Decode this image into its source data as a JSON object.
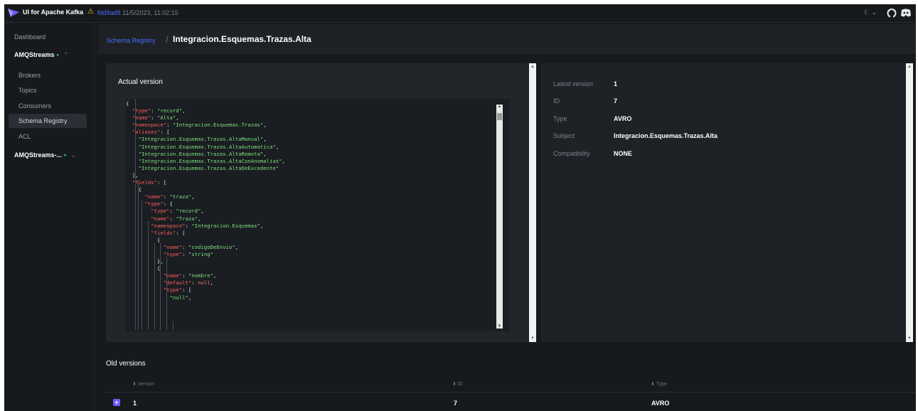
{
  "app": {
    "title": "UI for Apache Kafka",
    "commit_hash": "fdd9ad9",
    "commit_date": "11/5/2023, 11:02:15",
    "theme_toggle": "☾ ⌄"
  },
  "sidebar": {
    "dashboard": "Dashboard",
    "cluster1": "AMQStreams",
    "items": [
      "Brokers",
      "Topics",
      "Consumers",
      "Schema Registry",
      "ACL"
    ],
    "cluster2": "AMQStreams-..."
  },
  "breadcrumb": {
    "link": "Schema Registry",
    "separator": "/",
    "title": "Integracion.Esquemas.Trazas.Alta"
  },
  "schema": {
    "actual_label": "Actual version",
    "lines": [
      [
        [
          "{",
          "p"
        ]
      ],
      [
        [
          "  ",
          "p"
        ],
        [
          "\"type\"",
          "k"
        ],
        [
          ": ",
          "p"
        ],
        [
          "\"record\"",
          "s"
        ],
        [
          ",",
          "p"
        ]
      ],
      [
        [
          "  ",
          "p"
        ],
        [
          "\"name\"",
          "k"
        ],
        [
          ": ",
          "p"
        ],
        [
          "\"Alta\"",
          "s"
        ],
        [
          ",",
          "p"
        ]
      ],
      [
        [
          "  ",
          "p"
        ],
        [
          "\"namespace\"",
          "k"
        ],
        [
          ": ",
          "p"
        ],
        [
          "\"Integracion.Esquemas.Trazas\"",
          "s"
        ],
        [
          ",",
          "p"
        ]
      ],
      [
        [
          "  ",
          "p"
        ],
        [
          "\"aliases\"",
          "k"
        ],
        [
          ": [",
          "p"
        ]
      ],
      [
        [
          "    ",
          "p"
        ],
        [
          "\"Integracion.Esquemas.Trazas.AltaManual\"",
          "s"
        ],
        [
          ",",
          "p"
        ]
      ],
      [
        [
          "    ",
          "p"
        ],
        [
          "\"Integracion.Esquemas.Trazas.AltaAutomatica\"",
          "s"
        ],
        [
          ",",
          "p"
        ]
      ],
      [
        [
          "    ",
          "p"
        ],
        [
          "\"Integracion.Esquemas.Trazas.AltaRemota\"",
          "s"
        ],
        [
          ",",
          "p"
        ]
      ],
      [
        [
          "    ",
          "p"
        ],
        [
          "\"Integracion.Esquemas.Trazas.AltaConAnomalias\"",
          "s"
        ],
        [
          ",",
          "p"
        ]
      ],
      [
        [
          "    ",
          "p"
        ],
        [
          "\"Integracion.Esquemas.Trazas.AltaDeExcedente\"",
          "s"
        ]
      ],
      [
        [
          "  ],",
          "p"
        ]
      ],
      [
        [
          "  ",
          "p"
        ],
        [
          "\"fields\"",
          "k"
        ],
        [
          ": [",
          "p"
        ]
      ],
      [
        [
          "    {",
          "p"
        ]
      ],
      [
        [
          "      ",
          "p"
        ],
        [
          "\"name\"",
          "k"
        ],
        [
          ": ",
          "p"
        ],
        [
          "\"traza\"",
          "s"
        ],
        [
          ",",
          "p"
        ]
      ],
      [
        [
          "      ",
          "p"
        ],
        [
          "\"type\"",
          "k"
        ],
        [
          ": {",
          "p"
        ]
      ],
      [
        [
          "        ",
          "p"
        ],
        [
          "\"type\"",
          "k"
        ],
        [
          ": ",
          "p"
        ],
        [
          "\"record\"",
          "s"
        ],
        [
          ",",
          "p"
        ]
      ],
      [
        [
          "        ",
          "p"
        ],
        [
          "\"name\"",
          "k"
        ],
        [
          ": ",
          "p"
        ],
        [
          "\"Traza\"",
          "s"
        ],
        [
          ",",
          "p"
        ]
      ],
      [
        [
          "        ",
          "p"
        ],
        [
          "\"namespace\"",
          "k"
        ],
        [
          ": ",
          "p"
        ],
        [
          "\"Integracion.Esquemas\"",
          "s"
        ],
        [
          ",",
          "p"
        ]
      ],
      [
        [
          "        ",
          "p"
        ],
        [
          "\"fields\"",
          "k"
        ],
        [
          ": [",
          "p"
        ]
      ],
      [
        [
          "          {",
          "p"
        ]
      ],
      [
        [
          "            ",
          "p"
        ],
        [
          "\"name\"",
          "k"
        ],
        [
          ": ",
          "p"
        ],
        [
          "\"codigoDeEnvio\"",
          "s"
        ],
        [
          ",",
          "p"
        ]
      ],
      [
        [
          "            ",
          "p"
        ],
        [
          "\"type\"",
          "k"
        ],
        [
          ": ",
          "p"
        ],
        [
          "\"string\"",
          "s"
        ]
      ],
      [
        [
          "          },",
          "p"
        ]
      ],
      [
        [
          "          {",
          "p"
        ]
      ],
      [
        [
          "            ",
          "p"
        ],
        [
          "\"name\"",
          "k"
        ],
        [
          ": ",
          "p"
        ],
        [
          "\"nombre\"",
          "s"
        ],
        [
          ",",
          "p"
        ]
      ],
      [
        [
          "            ",
          "p"
        ],
        [
          "\"default\"",
          "k"
        ],
        [
          ": ",
          "p"
        ],
        [
          "null",
          "n"
        ],
        [
          ",",
          "p"
        ]
      ],
      [
        [
          "            ",
          "p"
        ],
        [
          "\"type\"",
          "k"
        ],
        [
          ": [",
          "p"
        ]
      ],
      [
        [
          "              ",
          "p"
        ],
        [
          "\"null\"",
          "s"
        ],
        [
          ",",
          "p"
        ]
      ]
    ]
  },
  "details": {
    "rows": [
      {
        "label": "Latest version",
        "value": "1"
      },
      {
        "label": "ID",
        "value": "7"
      },
      {
        "label": "Type",
        "value": "AVRO"
      },
      {
        "label": "Subject",
        "value": "Integracion.Esquemas.Trazas.Alta"
      },
      {
        "label": "Compatibility",
        "value": "NONE"
      }
    ]
  },
  "old_versions": {
    "title": "Old versions",
    "columns": [
      "Version",
      "ID",
      "Type"
    ],
    "rows": [
      {
        "version": "1",
        "id": "7",
        "type": "AVRO"
      }
    ]
  }
}
